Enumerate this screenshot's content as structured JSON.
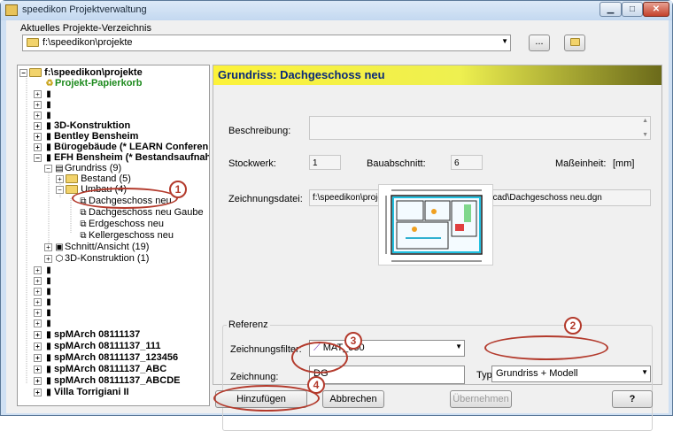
{
  "window": {
    "title": "speedikon Projektverwaltung"
  },
  "project_dir": {
    "label": "Aktuelles Projekte-Verzeichnis",
    "value": "f:\\speedikon\\projekte",
    "browse_label": "..."
  },
  "tree": {
    "items": [
      {
        "label": "f:\\speedikon\\projekte",
        "bold": true
      },
      {
        "label": "Projekt-Papierkorb",
        "bold": true
      },
      {
        "label": ""
      },
      {
        "label": ""
      },
      {
        "label": ""
      },
      {
        "label": "3D-Konstruktion",
        "bold": true
      },
      {
        "label": "Bentley Bensheim",
        "bold": true
      },
      {
        "label": "Bürogebäude   (* LEARN Conferen",
        "bold": true
      },
      {
        "label": "EFH Bensheim   (* Bestandsaufnah",
        "bold": true
      },
      {
        "label": "Grundriss (9)"
      },
      {
        "label": "Bestand (5)"
      },
      {
        "label": "Umbau (4)"
      },
      {
        "label": "Dachgeschoss neu"
      },
      {
        "label": "Dachgeschoss neu Gaube"
      },
      {
        "label": "Erdgeschoss neu"
      },
      {
        "label": "Kellergeschoss neu"
      },
      {
        "label": "Schnitt/Ansicht (19)"
      },
      {
        "label": "3D-Konstruktion (1)"
      },
      {
        "label": ""
      },
      {
        "label": ""
      },
      {
        "label": ""
      },
      {
        "label": ""
      },
      {
        "label": ""
      },
      {
        "label": ""
      },
      {
        "label": "spMArch 08111137",
        "bold": true
      },
      {
        "label": "spMArch 08111137_111",
        "bold": true
      },
      {
        "label": "spMArch 08111137_123456",
        "bold": true
      },
      {
        "label": "spMArch 08111137_ABC",
        "bold": true
      },
      {
        "label": "spMArch 08111137_ABCDE",
        "bold": true
      },
      {
        "label": "Villa Torrigiani II",
        "bold": true
      }
    ]
  },
  "detail": {
    "header": "Grundriss: Dachgeschoss neu",
    "beschreibung_label": "Beschreibung:",
    "stockwerk_label": "Stockwerk:",
    "stockwerk_value": "1",
    "bauabschnitt_label": "Bauabschnitt:",
    "bauabschnitt_value": "6",
    "masseinheit_label": "Maßeinheit:",
    "masseinheit_value": "[mm]",
    "zeichnungsdatei_label": "Zeichnungsdatei:",
    "zeichnungsdatei_value": "f:\\speedikon\\projekte\\EFH Bensheim.bpd\\des\\cad\\Dachgeschoss neu.dgn"
  },
  "referenz": {
    "group_label": "Referenz",
    "filter_label": "Zeichnungsfilter:",
    "filter_value": "MAT_050",
    "zeichnung_label": "Zeichnung:",
    "zeichnung_value": "DG",
    "typ_label": "Typ:",
    "typ_value": "Grundriss + Modell"
  },
  "buttons": {
    "hinzufuegen": "Hinzufügen",
    "abbrechen": "Abbrechen",
    "uebernehmen": "Übernehmen",
    "help": "?"
  },
  "annotations": [
    "1",
    "2",
    "3",
    "4"
  ],
  "colors": {
    "header_yellow": "#fcf23a",
    "header_text": "#0a2a7a",
    "annotation_red": "#b33a2c",
    "trash_green": "#1d8a1d"
  }
}
